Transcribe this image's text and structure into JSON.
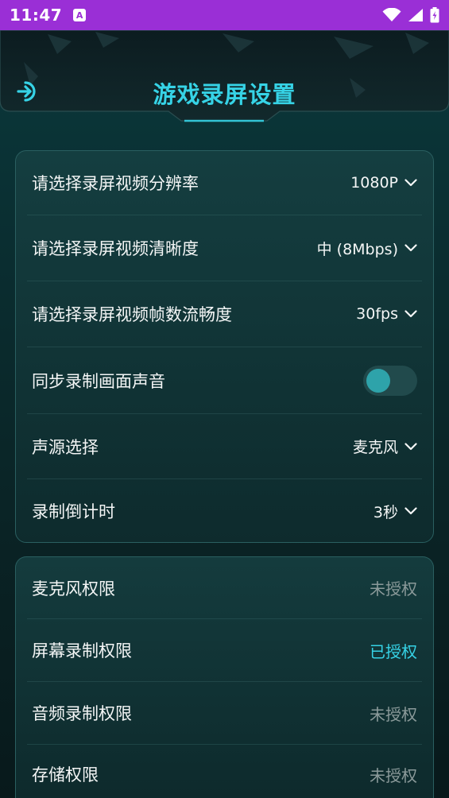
{
  "status_bar": {
    "time": "11:47",
    "notification_icon": "A"
  },
  "header": {
    "title": "游戏录屏设置",
    "back_icon": "back-arrow-icon"
  },
  "settings": {
    "resolution": {
      "label": "请选择录屏视频分辨率",
      "value": "1080P"
    },
    "clarity": {
      "label": "请选择录屏视频清晰度",
      "value": "中 (8Mbps)"
    },
    "framerate": {
      "label": "请选择录屏视频帧数流畅度",
      "value": "30fps"
    },
    "sync_audio": {
      "label": "同步录制画面声音",
      "enabled": false
    },
    "audio_source": {
      "label": "声源选择",
      "value": "麦克风"
    },
    "countdown": {
      "label": "录制倒计时",
      "value": "3秒"
    }
  },
  "permissions": {
    "microphone": {
      "label": "麦克风权限",
      "status": "未授权"
    },
    "screen": {
      "label": "屏幕录制权限",
      "status": "已授权"
    },
    "audio": {
      "label": "音频录制权限",
      "status": "未授权"
    },
    "storage": {
      "label": "存储权限",
      "status": "未授权"
    }
  },
  "colors": {
    "accent": "#36d3e6",
    "status_bar": "#9a2fd6",
    "muted": "#8b9a9a"
  }
}
